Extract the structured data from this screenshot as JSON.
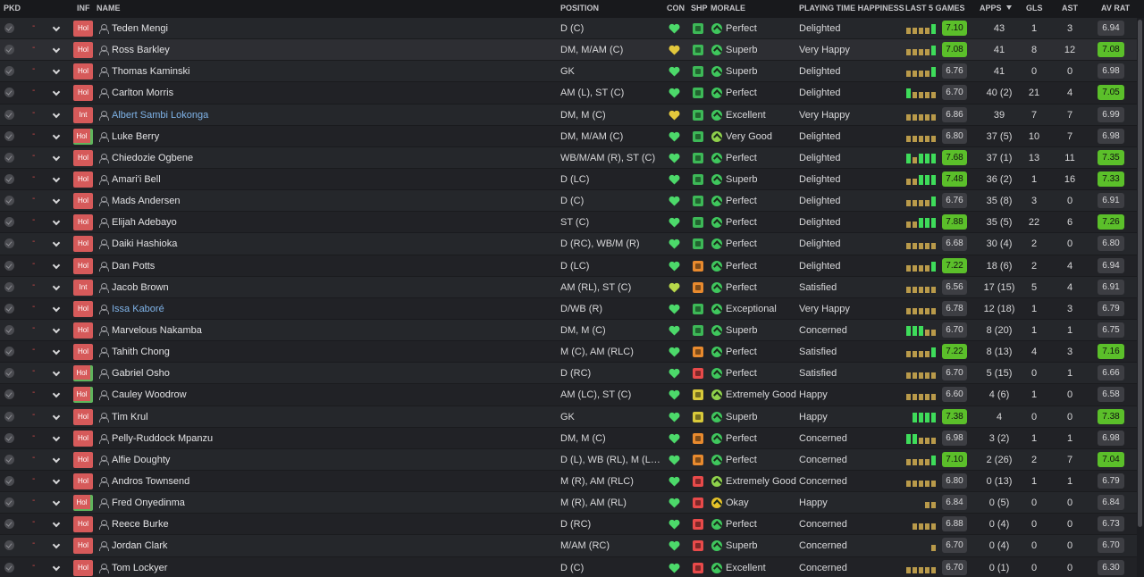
{
  "headers": {
    "pkd": "PKD",
    "inf": "INF",
    "name": "NAME",
    "position": "POSITION",
    "con": "CON",
    "shp": "SHP",
    "morale": "MORALE",
    "pth": "PLAYING TIME HAPPINESS",
    "last5": "LAST 5 GAMES",
    "apps": "APPS",
    "gls": "GLS",
    "ast": "AST",
    "avrat": "AV RAT"
  },
  "colors": {
    "con_green": "#4cd96a",
    "con_yellow": "#e3c83c",
    "ship_green": "#3db857",
    "ship_orange": "#e88a2e",
    "ship_red": "#e84a4a",
    "ship_yellow": "#d8c93a",
    "morale_green": "#3fc75d",
    "morale_light": "#8fd14b",
    "morale_yellow": "#e6c229",
    "rating_bright": "#5bbf2a",
    "rating_grey": "#3d3e43"
  },
  "players": [
    {
      "inf": "Hol",
      "name": "Teden Mengi",
      "pos": "D (C)",
      "con": "green",
      "ship": "green",
      "morale": "Perfect",
      "pth": "Delighted",
      "last5": "7.10",
      "apps": "43",
      "gls": "1",
      "ast": "3",
      "avrat": "6.94",
      "form": [
        "o",
        "o",
        "o",
        "o",
        "g"
      ],
      "l5hi": true,
      "avhi": false
    },
    {
      "inf": "Hol",
      "name": "Ross Barkley",
      "pos": "DM, M/AM (C)",
      "con": "yellow",
      "ship": "green",
      "morale": "Superb",
      "pth": "Very Happy",
      "last5": "7.08",
      "apps": "41",
      "gls": "8",
      "ast": "12",
      "avrat": "7.08",
      "form": [
        "o",
        "o",
        "o",
        "o",
        "g"
      ],
      "l5hi": true,
      "avhi": true,
      "hl": true
    },
    {
      "inf": "Hol",
      "name": "Thomas Kaminski",
      "pos": "GK",
      "con": "green",
      "ship": "green",
      "morale": "Superb",
      "pth": "Delighted",
      "last5": "6.76",
      "apps": "41",
      "gls": "0",
      "ast": "0",
      "avrat": "6.98",
      "form": [
        "o",
        "o",
        "o",
        "o",
        "g"
      ],
      "l5hi": false,
      "avhi": false
    },
    {
      "inf": "Hol",
      "name": "Carlton Morris",
      "pos": "AM (L), ST (C)",
      "con": "green",
      "ship": "green",
      "morale": "Perfect",
      "pth": "Delighted",
      "last5": "6.70",
      "apps": "40 (2)",
      "gls": "21",
      "ast": "4",
      "avrat": "7.05",
      "form": [
        "g",
        "o",
        "o",
        "o",
        "o"
      ],
      "l5hi": false,
      "avhi": true
    },
    {
      "inf": "Int",
      "name": "Albert Sambi Lokonga",
      "pos": "DM, M (C)",
      "con": "yellow",
      "ship": "green",
      "morale": "Excellent",
      "pth": "Very Happy",
      "last5": "6.86",
      "apps": "39",
      "gls": "7",
      "ast": "7",
      "avrat": "6.99",
      "form": [
        "o",
        "o",
        "o",
        "o",
        "o"
      ],
      "l5hi": false,
      "avhi": false,
      "blue": true
    },
    {
      "inf": "Hol",
      "name": "Luke Berry",
      "pos": "DM, M/AM (C)",
      "con": "green",
      "ship": "green",
      "morale": "Very Good",
      "pth": "Delighted",
      "last5": "6.80",
      "apps": "37 (5)",
      "gls": "10",
      "ast": "7",
      "avrat": "6.98",
      "form": [
        "o",
        "o",
        "o",
        "o",
        "o"
      ],
      "l5hi": false,
      "avhi": false,
      "ginf": true
    },
    {
      "inf": "Hol",
      "name": "Chiedozie Ogbene",
      "pos": "WB/M/AM (R), ST (C)",
      "con": "green",
      "ship": "green",
      "morale": "Perfect",
      "pth": "Delighted",
      "last5": "7.68",
      "apps": "37 (1)",
      "gls": "13",
      "ast": "11",
      "avrat": "7.35",
      "form": [
        "g",
        "o",
        "g",
        "g",
        "g"
      ],
      "l5hi": true,
      "avhi": true
    },
    {
      "inf": "Hol",
      "name": "Amari'i Bell",
      "pos": "D (LC)",
      "con": "green",
      "ship": "green",
      "morale": "Superb",
      "pth": "Delighted",
      "last5": "7.48",
      "apps": "36 (2)",
      "gls": "1",
      "ast": "16",
      "avrat": "7.33",
      "form": [
        "o",
        "o",
        "g",
        "g",
        "g"
      ],
      "l5hi": true,
      "avhi": true
    },
    {
      "inf": "Hol",
      "name": "Mads Andersen",
      "pos": "D (C)",
      "con": "green",
      "ship": "green",
      "morale": "Perfect",
      "pth": "Delighted",
      "last5": "6.76",
      "apps": "35 (8)",
      "gls": "3",
      "ast": "0",
      "avrat": "6.91",
      "form": [
        "o",
        "o",
        "o",
        "o",
        "g"
      ],
      "l5hi": false,
      "avhi": false
    },
    {
      "inf": "Hol",
      "name": "Elijah Adebayo",
      "pos": "ST (C)",
      "con": "green",
      "ship": "green",
      "morale": "Perfect",
      "pth": "Delighted",
      "last5": "7.88",
      "apps": "35 (5)",
      "gls": "22",
      "ast": "6",
      "avrat": "7.26",
      "form": [
        "o",
        "o",
        "g",
        "g",
        "g"
      ],
      "l5hi": true,
      "avhi": true
    },
    {
      "inf": "Hol",
      "name": "Daiki Hashioka",
      "pos": "D (RC), WB/M (R)",
      "con": "green",
      "ship": "green",
      "morale": "Perfect",
      "pth": "Delighted",
      "last5": "6.68",
      "apps": "30 (4)",
      "gls": "2",
      "ast": "0",
      "avrat": "6.80",
      "form": [
        "o",
        "o",
        "o",
        "o",
        "o"
      ],
      "l5hi": false,
      "avhi": false
    },
    {
      "inf": "Hol",
      "name": "Dan Potts",
      "pos": "D (LC)",
      "con": "green",
      "ship": "orange",
      "morale": "Perfect",
      "pth": "Delighted",
      "last5": "7.22",
      "apps": "18 (6)",
      "gls": "2",
      "ast": "4",
      "avrat": "6.94",
      "form": [
        "o",
        "o",
        "o",
        "o",
        "g"
      ],
      "l5hi": true,
      "avhi": false
    },
    {
      "inf": "Int",
      "name": "Jacob Brown",
      "pos": "AM (RL), ST (C)",
      "con": "yellowgreen",
      "ship": "orange",
      "morale": "Perfect",
      "pth": "Satisfied",
      "last5": "6.56",
      "apps": "17 (15)",
      "gls": "5",
      "ast": "4",
      "avrat": "6.91",
      "form": [
        "o",
        "o",
        "o",
        "o",
        "o"
      ],
      "l5hi": false,
      "avhi": false
    },
    {
      "inf": "Hol",
      "name": "Issa Kaboré",
      "pos": "D/WB (R)",
      "con": "green",
      "ship": "green",
      "morale": "Exceptional",
      "pth": "Very Happy",
      "last5": "6.78",
      "apps": "12 (18)",
      "gls": "1",
      "ast": "3",
      "avrat": "6.79",
      "form": [
        "o",
        "o",
        "o",
        "o",
        "o"
      ],
      "l5hi": false,
      "avhi": false,
      "blue": true
    },
    {
      "inf": "Hol",
      "name": "Marvelous Nakamba",
      "pos": "DM, M (C)",
      "con": "green",
      "ship": "green",
      "morale": "Superb",
      "pth": "Concerned",
      "last5": "6.70",
      "apps": "8 (20)",
      "gls": "1",
      "ast": "1",
      "avrat": "6.75",
      "form": [
        "g",
        "g",
        "g",
        "o",
        "o"
      ],
      "l5hi": false,
      "avhi": false
    },
    {
      "inf": "Hol",
      "name": "Tahith Chong",
      "pos": "M (C), AM (RLC)",
      "con": "green",
      "ship": "orange",
      "morale": "Perfect",
      "pth": "Satisfied",
      "last5": "7.22",
      "apps": "8 (13)",
      "gls": "4",
      "ast": "3",
      "avrat": "7.16",
      "form": [
        "o",
        "o",
        "o",
        "o",
        "g"
      ],
      "l5hi": true,
      "avhi": true
    },
    {
      "inf": "Hol",
      "name": "Gabriel Osho",
      "pos": "D (RC)",
      "con": "green",
      "ship": "red",
      "morale": "Perfect",
      "pth": "Satisfied",
      "last5": "6.70",
      "apps": "5 (15)",
      "gls": "0",
      "ast": "1",
      "avrat": "6.66",
      "form": [
        "o",
        "o",
        "o",
        "o",
        "o"
      ],
      "l5hi": false,
      "avhi": false,
      "ginf": true
    },
    {
      "inf": "Hol",
      "name": "Cauley Woodrow",
      "pos": "AM (LC), ST (C)",
      "con": "green",
      "ship": "yellow",
      "morale": "Extremely Good",
      "pth": "Happy",
      "last5": "6.60",
      "apps": "4 (6)",
      "gls": "1",
      "ast": "0",
      "avrat": "6.58",
      "form": [
        "o",
        "o",
        "o",
        "o",
        "o"
      ],
      "l5hi": false,
      "avhi": false,
      "ginf": true
    },
    {
      "inf": "Hol",
      "name": "Tim Krul",
      "pos": "GK",
      "con": "green",
      "ship": "yellow",
      "morale": "Superb",
      "pth": "Happy",
      "last5": "7.38",
      "apps": "4",
      "gls": "0",
      "ast": "0",
      "avrat": "7.38",
      "form": [
        "",
        "g",
        "g",
        "g",
        "g"
      ],
      "l5hi": true,
      "avhi": true
    },
    {
      "inf": "Hol",
      "name": "Pelly-Ruddock Mpanzu",
      "pos": "DM, M (C)",
      "con": "green",
      "ship": "orange",
      "morale": "Perfect",
      "pth": "Concerned",
      "last5": "6.98",
      "apps": "3 (2)",
      "gls": "1",
      "ast": "1",
      "avrat": "6.98",
      "form": [
        "g",
        "g",
        "o",
        "o",
        "o"
      ],
      "l5hi": false,
      "avhi": false
    },
    {
      "inf": "Hol",
      "name": "Alfie Doughty",
      "pos": "D (L), WB (RL), M (L),...",
      "con": "green",
      "ship": "orange",
      "morale": "Perfect",
      "pth": "Concerned",
      "last5": "7.10",
      "apps": "2 (26)",
      "gls": "2",
      "ast": "7",
      "avrat": "7.04",
      "form": [
        "o",
        "o",
        "o",
        "o",
        "g"
      ],
      "l5hi": true,
      "avhi": true
    },
    {
      "inf": "Hol",
      "name": "Andros Townsend",
      "pos": "M (R), AM (RLC)",
      "con": "green",
      "ship": "red",
      "morale": "Extremely Good",
      "pth": "Concerned",
      "last5": "6.80",
      "apps": "0 (13)",
      "gls": "1",
      "ast": "1",
      "avrat": "6.79",
      "form": [
        "o",
        "o",
        "o",
        "o",
        "o"
      ],
      "l5hi": false,
      "avhi": false
    },
    {
      "inf": "Hol",
      "name": "Fred Onyedinma",
      "pos": "M (R), AM (RL)",
      "con": "green",
      "ship": "red",
      "morale": "Okay",
      "pth": "Happy",
      "last5": "6.84",
      "apps": "0 (5)",
      "gls": "0",
      "ast": "0",
      "avrat": "6.84",
      "form": [
        "",
        "",
        "",
        "o",
        "o"
      ],
      "l5hi": false,
      "avhi": false,
      "ginf": true,
      "mood": "yellow"
    },
    {
      "inf": "Hol",
      "name": "Reece Burke",
      "pos": "D (RC)",
      "con": "green",
      "ship": "red",
      "morale": "Perfect",
      "pth": "Concerned",
      "last5": "6.88",
      "apps": "0 (4)",
      "gls": "0",
      "ast": "0",
      "avrat": "6.73",
      "form": [
        "",
        "o",
        "o",
        "o",
        "o"
      ],
      "l5hi": false,
      "avhi": false
    },
    {
      "inf": "Hol",
      "name": "Jordan Clark",
      "pos": "M/AM (RC)",
      "con": "green",
      "ship": "red",
      "morale": "Superb",
      "pth": "Concerned",
      "last5": "6.70",
      "apps": "0 (4)",
      "gls": "0",
      "ast": "0",
      "avrat": "6.70",
      "form": [
        "",
        "",
        "",
        "",
        "o"
      ],
      "l5hi": false,
      "avhi": false
    },
    {
      "inf": "Hol",
      "name": "Tom Lockyer",
      "pos": "D (C)",
      "con": "green",
      "ship": "red",
      "morale": "Excellent",
      "pth": "Concerned",
      "last5": "6.70",
      "apps": "0 (1)",
      "gls": "0",
      "ast": "0",
      "avrat": "6.30",
      "form": [
        "o",
        "o",
        "o",
        "o",
        "o"
      ],
      "l5hi": false,
      "avhi": false
    }
  ]
}
